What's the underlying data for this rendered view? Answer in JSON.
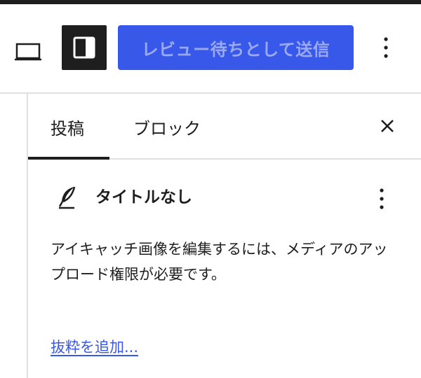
{
  "toolbar": {
    "device_preview_icon": "laptop-icon",
    "sidebar_toggle_icon": "sidebar-panel-icon",
    "submit_label": "レビュー待ちとして送信",
    "options_icon": "vertical-ellipsis-icon",
    "accent_color": "#3858e9"
  },
  "sidebar": {
    "tabs": [
      {
        "label": "投稿",
        "active": true
      },
      {
        "label": "ブロック",
        "active": false
      }
    ],
    "close_icon": "close-icon",
    "post": {
      "icon": "feather-icon",
      "title": "タイトルなし",
      "options_icon": "vertical-ellipsis-icon"
    },
    "featured_image_notice": "アイキャッチ画像を編集するには、メディアのアップロード権限が必要です。",
    "excerpt_link": "抜粋を追加..."
  }
}
